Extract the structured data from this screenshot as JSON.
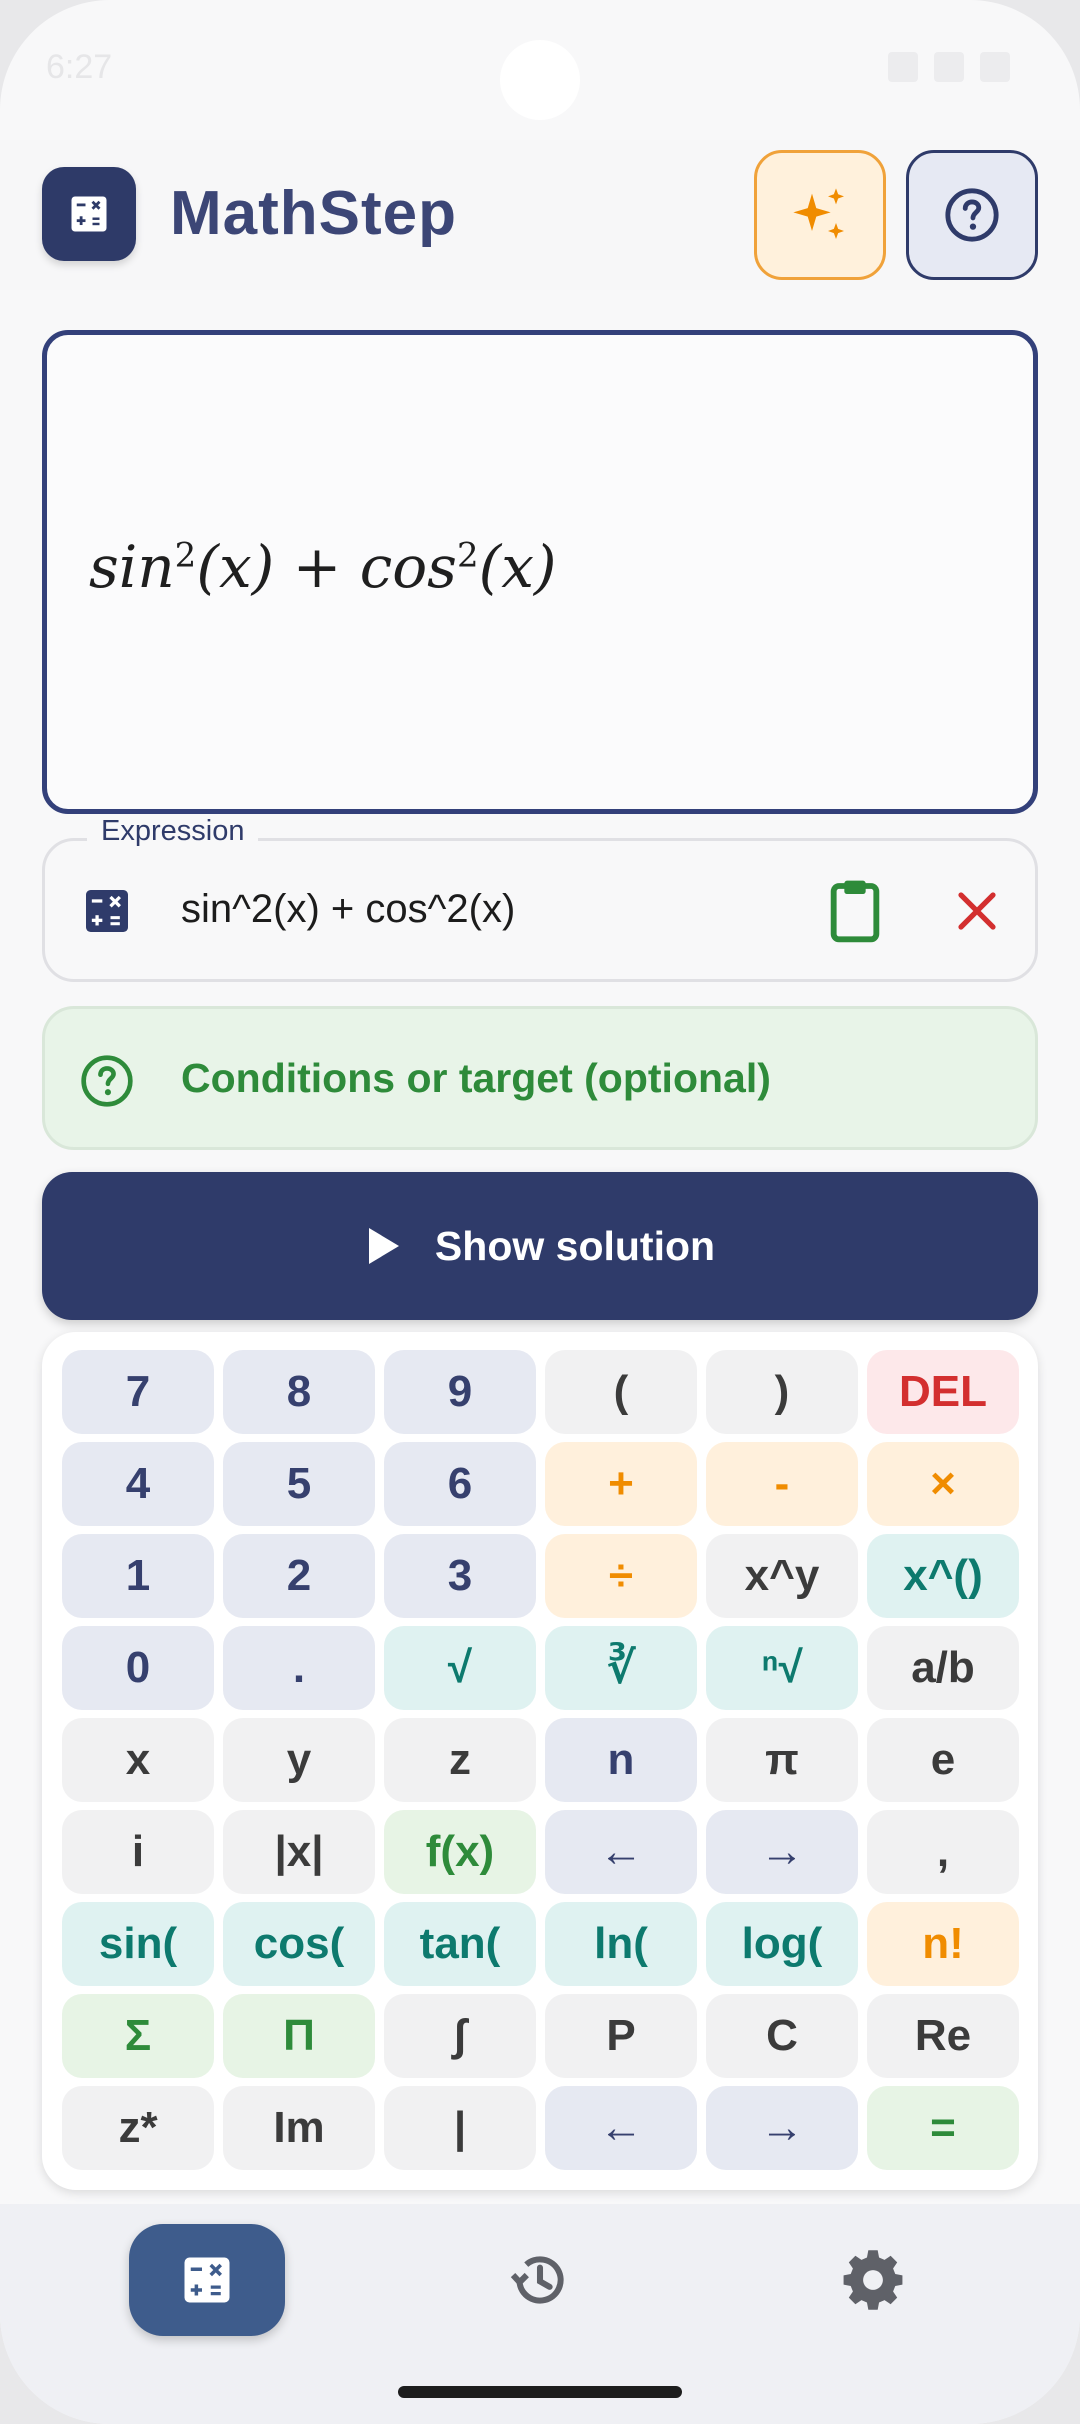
{
  "status_bar": {
    "time": "6:27"
  },
  "app": {
    "title": "MathStep"
  },
  "header": {
    "ai_icon": "sparkles-icon",
    "help_icon": "help-circle-icon"
  },
  "preview": {
    "base1": "sin",
    "exp1": "2",
    "arg1": "(x)",
    "plus": " + ",
    "base2": "cos",
    "exp2": "2",
    "arg2": "(x)"
  },
  "expression": {
    "label": "Expression",
    "value": "sin^2(x) + cos^2(x)",
    "icon": "calculator-icon",
    "paste_icon": "clipboard-icon",
    "clear_icon": "close-icon"
  },
  "conditions": {
    "placeholder": "Conditions or target (optional)",
    "icon": "help-circle-icon"
  },
  "solve": {
    "label": "Show solution",
    "icon": "play-icon"
  },
  "keypad": {
    "keys": [
      {
        "label": "7",
        "style": "num"
      },
      {
        "label": "8",
        "style": "num"
      },
      {
        "label": "9",
        "style": "num"
      },
      {
        "label": "(",
        "style": "gray"
      },
      {
        "label": ")",
        "style": "gray"
      },
      {
        "label": "DEL",
        "style": "del"
      },
      {
        "label": "4",
        "style": "num"
      },
      {
        "label": "5",
        "style": "num"
      },
      {
        "label": "6",
        "style": "num"
      },
      {
        "label": "+",
        "style": "orange"
      },
      {
        "label": "-",
        "style": "orange"
      },
      {
        "label": "×",
        "style": "orange"
      },
      {
        "label": "1",
        "style": "num"
      },
      {
        "label": "2",
        "style": "num"
      },
      {
        "label": "3",
        "style": "num"
      },
      {
        "label": "÷",
        "style": "orange"
      },
      {
        "label": "x^y",
        "style": "gray"
      },
      {
        "label": "x^()",
        "style": "teal"
      },
      {
        "label": "0",
        "style": "num"
      },
      {
        "label": ".",
        "style": "num"
      },
      {
        "label": "√",
        "style": "teal"
      },
      {
        "label": "∛",
        "style": "teal"
      },
      {
        "label": "ⁿ√",
        "style": "teal"
      },
      {
        "label": "a/b",
        "style": "gray"
      },
      {
        "label": "x",
        "style": "gray"
      },
      {
        "label": "y",
        "style": "gray"
      },
      {
        "label": "z",
        "style": "gray"
      },
      {
        "label": "n",
        "style": "num"
      },
      {
        "label": "π",
        "style": "gray"
      },
      {
        "label": "e",
        "style": "gray"
      },
      {
        "label": "i",
        "style": "gray"
      },
      {
        "label": "|x|",
        "style": "gray"
      },
      {
        "label": "f(x)",
        "style": "green"
      },
      {
        "label": "←",
        "style": "nav"
      },
      {
        "label": "→",
        "style": "nav"
      },
      {
        "label": ",",
        "style": "gray"
      },
      {
        "label": "sin(",
        "style": "teal"
      },
      {
        "label": "cos(",
        "style": "teal"
      },
      {
        "label": "tan(",
        "style": "teal"
      },
      {
        "label": "ln(",
        "style": "teal"
      },
      {
        "label": "log(",
        "style": "teal"
      },
      {
        "label": "n!",
        "style": "orange"
      },
      {
        "label": "Σ",
        "style": "green"
      },
      {
        "label": "Π",
        "style": "green"
      },
      {
        "label": "∫",
        "style": "gray"
      },
      {
        "label": "P",
        "style": "gray"
      },
      {
        "label": "C",
        "style": "gray"
      },
      {
        "label": "Re",
        "style": "gray"
      },
      {
        "label": "z*",
        "style": "gray"
      },
      {
        "label": "Im",
        "style": "gray"
      },
      {
        "label": "|",
        "style": "gray"
      },
      {
        "label": "←",
        "style": "nav"
      },
      {
        "label": "→",
        "style": "nav"
      },
      {
        "label": "=",
        "style": "green"
      }
    ]
  },
  "bottom_nav": {
    "items": [
      {
        "name": "calculator",
        "icon": "calculator-icon",
        "active": true
      },
      {
        "name": "history",
        "icon": "history-icon",
        "active": false
      },
      {
        "name": "settings",
        "icon": "gear-icon",
        "active": false
      }
    ]
  },
  "colors": {
    "primary": "#2f3b6a",
    "accent_orange": "#f08c00",
    "success_green": "#2e8b3a",
    "danger_red": "#d32f2f",
    "teal": "#0d7a6e"
  }
}
